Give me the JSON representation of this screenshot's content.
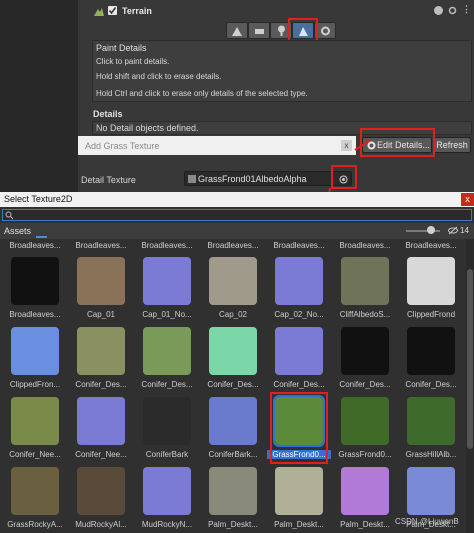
{
  "inspector": {
    "component_title": "Terrain",
    "tools": [
      "raise-lower-icon",
      "paint-texture-icon",
      "paint-trees-icon",
      "paint-details-icon",
      "terrain-settings-icon"
    ],
    "paint_details_title": "Paint Details",
    "help_lines": [
      "Click to paint details.",
      "Hold shift and click to erase details.",
      "Hold Ctrl and click to erase only details of the selected type."
    ],
    "details_section": "Details",
    "no_objects": "No Detail objects defined.",
    "edit_details_label": "Edit Details...",
    "refresh_label": "Refresh"
  },
  "add_grass": {
    "title": "Add Grass Texture",
    "detail_texture_label": "Detail Texture",
    "detail_texture_value": "GrassFrond01AlbedoAlpha"
  },
  "picker": {
    "title": "Select Texture2D",
    "close_label": "x",
    "search_placeholder": "",
    "tab_label": "Assets",
    "count_badge": "14",
    "top_row_labels": [
      "Broadleaves...",
      "Broadleaves...",
      "Broadleaves...",
      "Broadleaves...",
      "Broadleaves...",
      "Broadleaves...",
      "Broadleaves..."
    ],
    "rows": [
      [
        "Broadleaves...",
        "Cap_01",
        "Cap_01_No...",
        "Cap_02",
        "Cap_02_No...",
        "CliffAlbedoS...",
        "ClippedFrond"
      ],
      [
        "ClippedFron...",
        "Conifer_Des...",
        "Conifer_Des...",
        "Conifer_Des...",
        "Conifer_Des...",
        "Conifer_Des...",
        "Conifer_Des..."
      ],
      [
        "Conifer_Nee...",
        "Conifer_Nee...",
        "ConiferBark",
        "ConiferBark...",
        "GrassFrond0...",
        "GrassFrond0...",
        "GrassHillAlb..."
      ],
      [
        "GrassRockyA...",
        "MudRockyAl...",
        "MudRockyN...",
        "Palm_Deskt...",
        "Palm_Deskt...",
        "Palm_Deskt...",
        "Palm_Deskt..."
      ]
    ],
    "selected_label": "GrassFrond0...",
    "watermark": "CSDN @LiuwenB"
  },
  "colors": {
    "highlight_red": "#e0201e",
    "selection_blue": "#2f6fd6",
    "normal_map": "#7b7bd6"
  }
}
